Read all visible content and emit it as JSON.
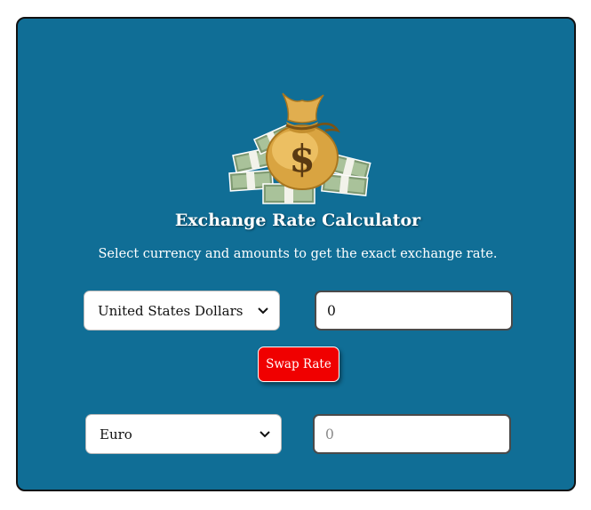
{
  "app": {
    "title": "Exchange Rate Calculator",
    "subtitle": "Select currency and amounts to get the exact exchange rate."
  },
  "logo": {
    "icon": "money-bag-icon",
    "symbol": "$"
  },
  "from": {
    "currency": "United States Dollars",
    "amount": "0"
  },
  "swap": {
    "label": "Swap Rate"
  },
  "to": {
    "currency": "Euro",
    "amount_placeholder": "0"
  },
  "colors": {
    "card_background": "#106e96",
    "swap_button": "#f00000",
    "text": "#ffffff"
  }
}
